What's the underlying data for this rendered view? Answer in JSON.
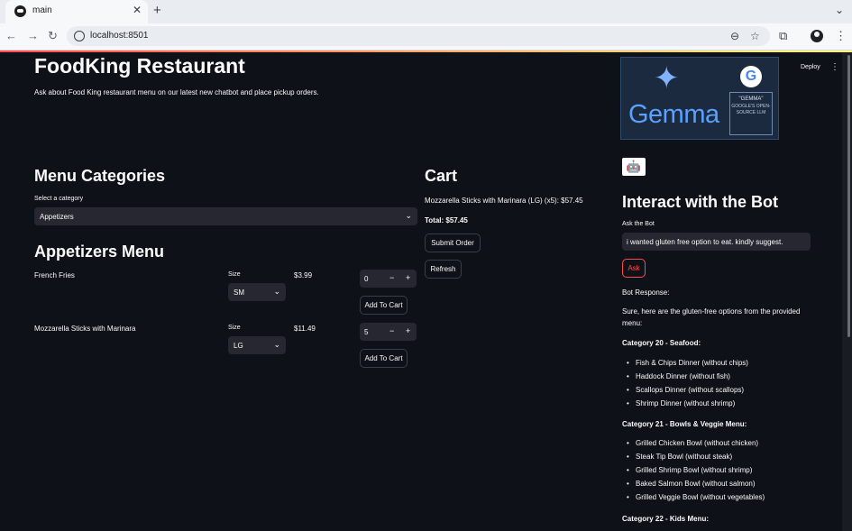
{
  "browser": {
    "tab_title": "main",
    "url": "localhost:8501"
  },
  "app": {
    "title": "FoodKing Restaurant",
    "subtitle": "Ask about Food King restaurant menu on our latest new chatbot and place pickup orders.",
    "deploy_label": "Deploy"
  },
  "menu": {
    "heading": "Menu Categories",
    "category_label": "Select a category",
    "selected_category": "Appetizers",
    "items_heading": "Appetizers Menu",
    "items": [
      {
        "name": "French Fries",
        "size_label": "Size",
        "size": "SM",
        "price": "$3.99",
        "quantity": "0",
        "add_label": "Add To Cart"
      },
      {
        "name": "Mozzarella Sticks with Marinara",
        "size_label": "Size",
        "size": "LG",
        "price": "$11.49",
        "quantity": "5",
        "add_label": "Add To Cart"
      }
    ]
  },
  "cart": {
    "heading": "Cart",
    "line": "Mozzarella Sticks with Marinara (LG) (x5): $57.45",
    "total": "Total: $57.45",
    "submit_label": "Submit Order",
    "refresh_label": "Refresh"
  },
  "bot": {
    "logo_text": "Gemma",
    "badge_title": "\"GEMMA\"",
    "badge_text": "GOOGLE'S OPEN-SOURCE LLM",
    "heading": "Interact with the Bot",
    "input_label": "Ask the Bot",
    "input_value": "i wanted gluten free option to eat. kindly suggest.",
    "ask_label": "Ask",
    "response_label": "Bot Response:",
    "response_intro": "Sure, here are the gluten-free options from the provided menu:",
    "sections": [
      {
        "title": "Category 20 - Seafood:",
        "items": [
          "Fish & Chips Dinner (without chips)",
          "Haddock Dinner (without fish)",
          "Scallops Dinner (without scallops)",
          "Shrimp Dinner (without shrimp)"
        ]
      },
      {
        "title": "Category 21 - Bowls & Veggie Menu:",
        "items": [
          "Grilled Chicken Bowl (without chicken)",
          "Steak Tip Bowl (without steak)",
          "Grilled Shrimp Bowl (without shrimp)",
          "Baked Salmon Bowl (without salmon)",
          "Grilled Veggie Bowl (without vegetables)"
        ]
      },
      {
        "title": "Category 22 - Kids Menu:",
        "items": []
      }
    ]
  },
  "colors": {
    "background": "#0e1117",
    "input_bg": "#262730",
    "accent": "#ff4b4b",
    "text": "#fafafa"
  }
}
